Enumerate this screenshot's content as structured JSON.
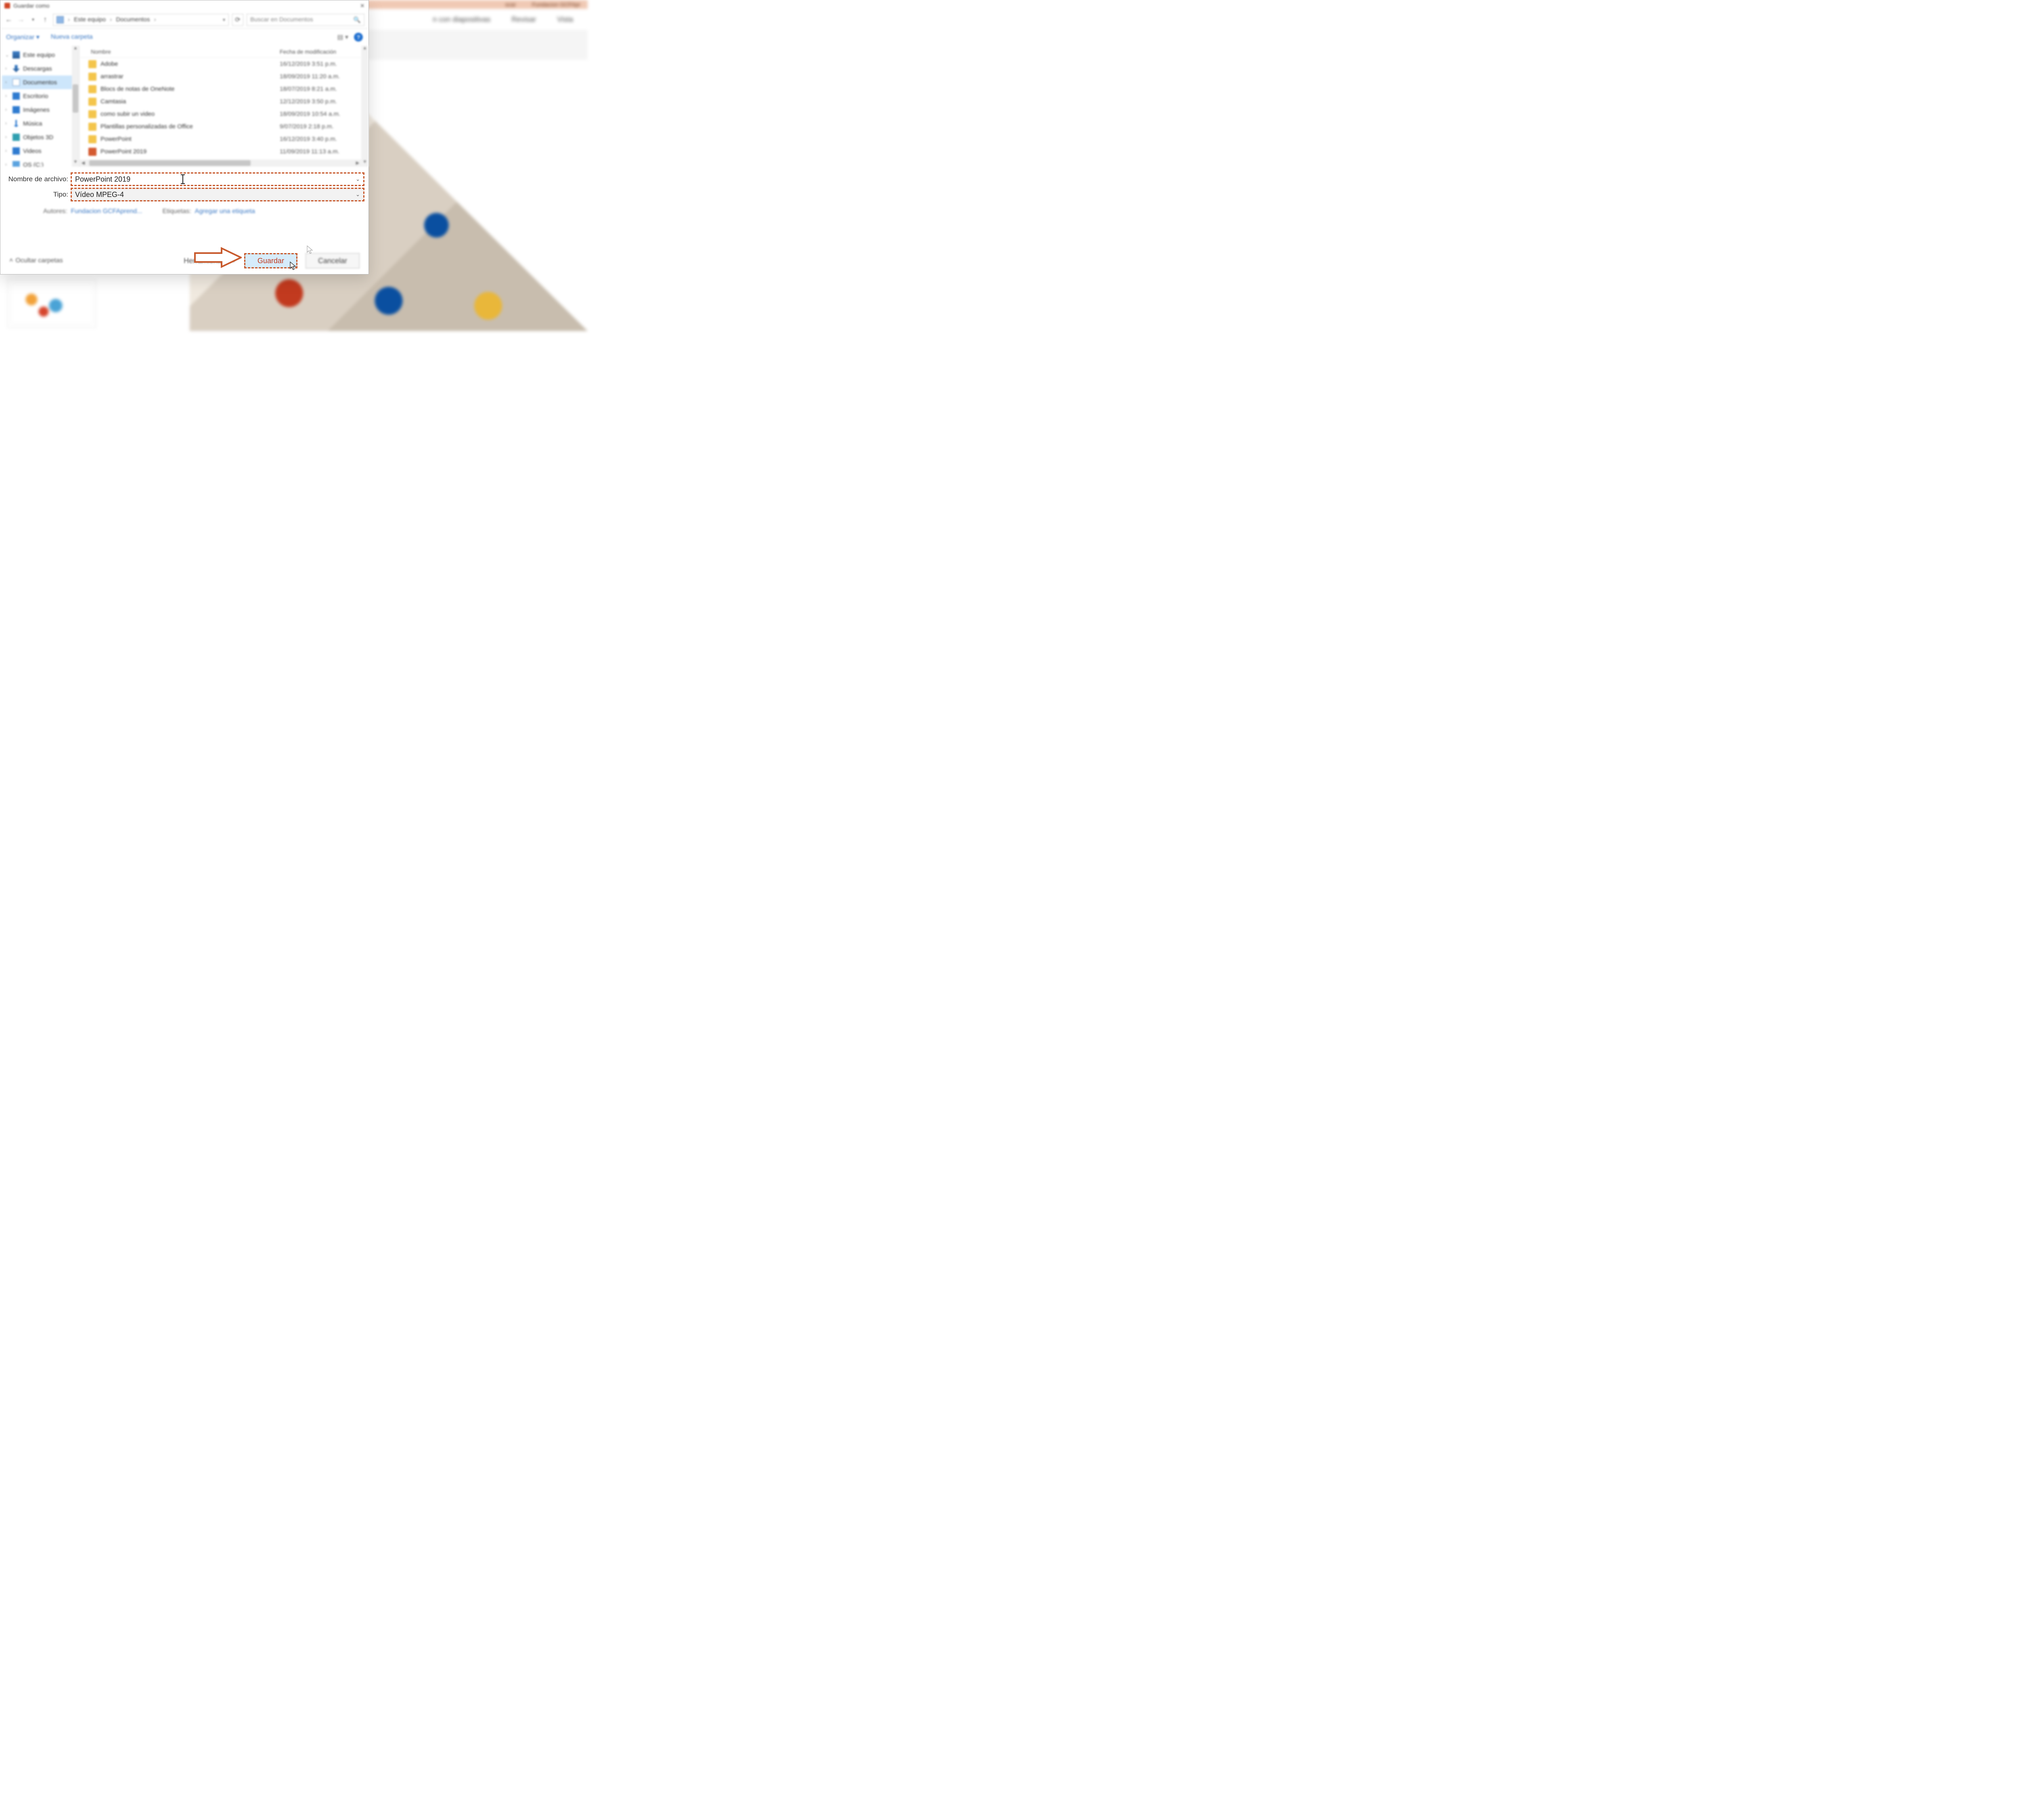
{
  "powerpoint": {
    "titlebar_search": "scar",
    "titlebar_user": "Fundacion GCFApr",
    "ribbon_tabs": {
      "slideshow": "n con diapositivas",
      "review": "Revisar",
      "view": "Vista"
    }
  },
  "dialog": {
    "title": "Guardar como",
    "nav": {
      "breadcrumb": {
        "root": "Este equipo",
        "folder": "Documentos"
      },
      "search_placeholder": "Buscar en Documentos"
    },
    "toolbar": {
      "organize": "Organizar",
      "new_folder": "Nueva carpeta"
    },
    "tree": [
      {
        "label": "Este equipo",
        "icon": "pc",
        "expander": "v"
      },
      {
        "label": "Descargas",
        "icon": "dl",
        "expander": ">"
      },
      {
        "label": "Documentos",
        "icon": "doc",
        "expander": ">",
        "selected": true
      },
      {
        "label": "Escritorio",
        "icon": "desk",
        "expander": ">"
      },
      {
        "label": "Imágenes",
        "icon": "img",
        "expander": ">"
      },
      {
        "label": "Música",
        "icon": "mus",
        "expander": ">"
      },
      {
        "label": "Objetos 3D",
        "icon": "3d",
        "expander": ">"
      },
      {
        "label": "Videos",
        "icon": "vid",
        "expander": ">"
      },
      {
        "label": "OS (C:)",
        "icon": "drv",
        "expander": ">"
      }
    ],
    "columns": {
      "name": "Nombre",
      "modified": "Fecha de modificación"
    },
    "files": [
      {
        "name": "Adobe",
        "date": "16/12/2019 3:51 p.m.",
        "kind": "folder"
      },
      {
        "name": "arrastrar",
        "date": "18/09/2019 11:20 a.m.",
        "kind": "folder"
      },
      {
        "name": "Blocs de notas de OneNote",
        "date": "18/07/2019 8:21 a.m.",
        "kind": "folder"
      },
      {
        "name": "Camtasia",
        "date": "12/12/2019 3:50 p.m.",
        "kind": "folder"
      },
      {
        "name": "como subir un video",
        "date": "18/09/2019 10:54 a.m.",
        "kind": "folder"
      },
      {
        "name": "Plantillas personalizadas de Office",
        "date": "9/07/2019 2:18 p.m.",
        "kind": "folder"
      },
      {
        "name": "PowerPoint",
        "date": "16/12/2019 3:40 p.m.",
        "kind": "folder"
      },
      {
        "name": "PowerPoint 2019",
        "date": "11/09/2019 11:13 a.m.",
        "kind": "ppt"
      }
    ],
    "fields": {
      "filename_label": "Nombre de archivo:",
      "filename_value": "PowerPoint 2019",
      "type_label": "Tipo:",
      "type_value": "Vídeo MPEG-4",
      "authors_label": "Autores:",
      "authors_value": "Fundacion GCFAprend...",
      "tags_label": "Etiquetas:",
      "tags_value": "Agregar una etiqueta"
    },
    "footer": {
      "hide_folders": "Ocultar carpetas",
      "tools": "Herramientas",
      "save": "Guardar",
      "cancel": "Cancelar"
    }
  }
}
